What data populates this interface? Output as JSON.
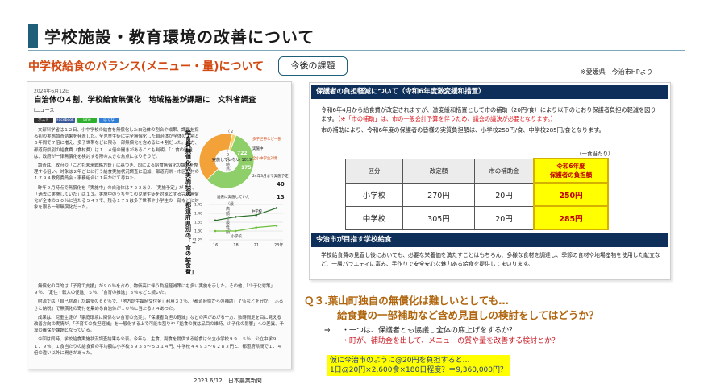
{
  "title": "学校施設・教育環境の改善について",
  "subtitle": "中学校給食のバランス(メニュー・量)について",
  "issue_badge": "今後の課題",
  "source_note": "※愛媛県　今治市HPより",
  "news": {
    "date": "2024年6月12日",
    "headline": "自治体の４割、学校給食無償化　地域格差が課題に　文科省調査",
    "source": "iニュース",
    "share_buttons": [
      "ポスト",
      "Facebook",
      "Line",
      "はてな"
    ],
    "body": [
      "文部科学省は１２日、小中学校の給食を無償化した自治体の割合や成果、課題を探る初の実態調査結果を発表した。全児童生徒に完全無償化した自治体が全体の３割と６年間で７倍に増え、多子世帯などに限る一部無償化を含めると４割だった。一方、都道府県別の給食費（食材費）は１．４倍の開きがあることも判明。「１食の残量は、政府が一律無償化を検討する際の大きな焦点になりそうだ。",
      "調査は、政府の「こども未来戦略方針」に基づき、国による給食無償化の課題を整理する狙い。対象は２年ごとに行う給食実施状況調査に追加、都道府県・市区町村の１７９４教育委員会・事務組合に１年かけて尋ねた。",
      "昨年９月時点で無償化を「実施中」の自治体は７２２あり、「実施予定」が４０、「過去に実施していた」は１３。実施中のうち全ての児童生徒を対象とする完全無償化が全体の３０％に当たる５４７で、残る１７５は多子世帯や小学生の一部などに対象を限る一部無償化だった。"
    ],
    "bottom": [
      "無償化の目的は「子育て支援」が９０％を占め、物価高に伴う負担軽減策にも多い実施を示した。その他、「少子化対策」９％、「定住・転入の促進」５％、「食育の推進」３％などと続いた。",
      "財源では「自己財源」が最多の６６％で、「地方創生臨時交付金」利用３２％、「都道府県からの補助」７％などを分か、「ふるさと納税」で無償化の寄付を集める自治体が１０％に当たる７４あった。",
      "成果は、児童生徒が「家庭環境に関係ない食育の充実」、「保護者負担の軽減」などの声があがる一方、数時間足を目に見える改善方向の実情が、「子育ての負担軽減」を一般化する上で可能な割りや「給食の質は品目の維持、少子化の影響」への差異、予算の確保が課題となっている。",
      "今回は同時、学校給食実施状況調査結果も公表。今年も、主食、副食を提供する給食は公立小学校９９．５％、公立中学９１．９％、１食当たりの給食費の平均額は小学校３９３３～５３１４円、中学校４４９３～６２８２円と、都道府県間で１．４倍の違い以外に開きがあった。"
    ],
    "vertical_titles": {
      "donut": "給食費無償化の実施状況",
      "donut_sub": "（２０２３年９月時点）",
      "line": "都道府県別の「１食の給食費」",
      "line_sub": "（最高額と最低額）"
    },
    "footer": "2023.6/12　日本農業新聞"
  },
  "chart_data": [
    {
      "type": "pie",
      "categories": [
        "実施していない",
        "実施中",
        "実施予定"
      ],
      "values": [
        1019,
        722,
        40
      ],
      "colors": [
        "#8fcf6a",
        "#f3a23a",
        "#f7d36a"
      ],
      "labels": {
        "center": "実施していない 1019",
        "a": "722",
        "b": "547",
        "c": "175",
        "legend1": "多子世帯など一部",
        "legend2": "実施中",
        "legend3": "全小中学生対象",
        "planned": "24年3月まで実施予定",
        "planned_value": "40",
        "past": "過去に実施していた",
        "past_value": "13"
      }
    },
    {
      "type": "line",
      "x": [
        "16",
        "18",
        "21",
        "23年"
      ],
      "series": [
        {
          "name": "中学校",
          "values": [
            1.36,
            1.38,
            1.39,
            1.43
          ]
        },
        {
          "name": "小学校",
          "values": [
            1.3,
            1.3,
            1.32,
            1.33
          ]
        }
      ],
      "ylim": [
        1.25,
        1.45
      ],
      "yticks": [
        "1.45",
        "1.40",
        "1.35",
        "1.30",
        "1.25"
      ],
      "unit": "倍"
    }
  ],
  "panel": {
    "head1": "保護者の負担軽減について（令和6年度激変緩和措置）",
    "text1": "令和6年4月から給食費が改定されますが、激変緩和措置として市の補助（20円/食）により以下のとおり保護者負担の軽減を図ります。",
    "text1_red": "（※「市の補助」は、市の一般会計予算を伴うため、議会の議決が必要となります。）",
    "text2": "市の補助により、令和6年度の保護者の皆様の実質負担額は、小学校250円/食、中学校285円/食となります。",
    "unit_note": "（一食当たり）",
    "table": {
      "headers": [
        "区分",
        "改定額",
        "市の補助金",
        "令和6年度",
        "保護者の負担額"
      ],
      "rows": [
        [
          "小学校",
          "270円",
          "20円",
          "250円"
        ],
        [
          "中学校",
          "305円",
          "20円",
          "285円"
        ]
      ]
    },
    "head2": "今治市が目指す学校給食",
    "text3": "学校給食費の見直し後においても、必要な栄養価を満たすことはもちろん、多様な食材を調達し、季節の食材や地場産物を使用した献立など、一層バラエティに富み、手作りで安全安心な魅力ある給食を提供してまいります。"
  },
  "question": {
    "line1": "Ｑ３.葉山町独自の無償化は難しいとしても…",
    "line2": "給食費の一部補助など含め見直しの検討をしてはどうか？"
  },
  "answer": {
    "arrow": "⇒",
    "line1": "・一つは、保護者とも協議し全体の底上げをするか？",
    "line2": "・町が、補助金を出して、メニューの質や量を改善する検討とか？"
  },
  "highlight": {
    "line1": "仮に今治市のように@20円を負担すると…",
    "line2": "1日@20円×2,600食×180日程度？＝9,360,000円？"
  }
}
